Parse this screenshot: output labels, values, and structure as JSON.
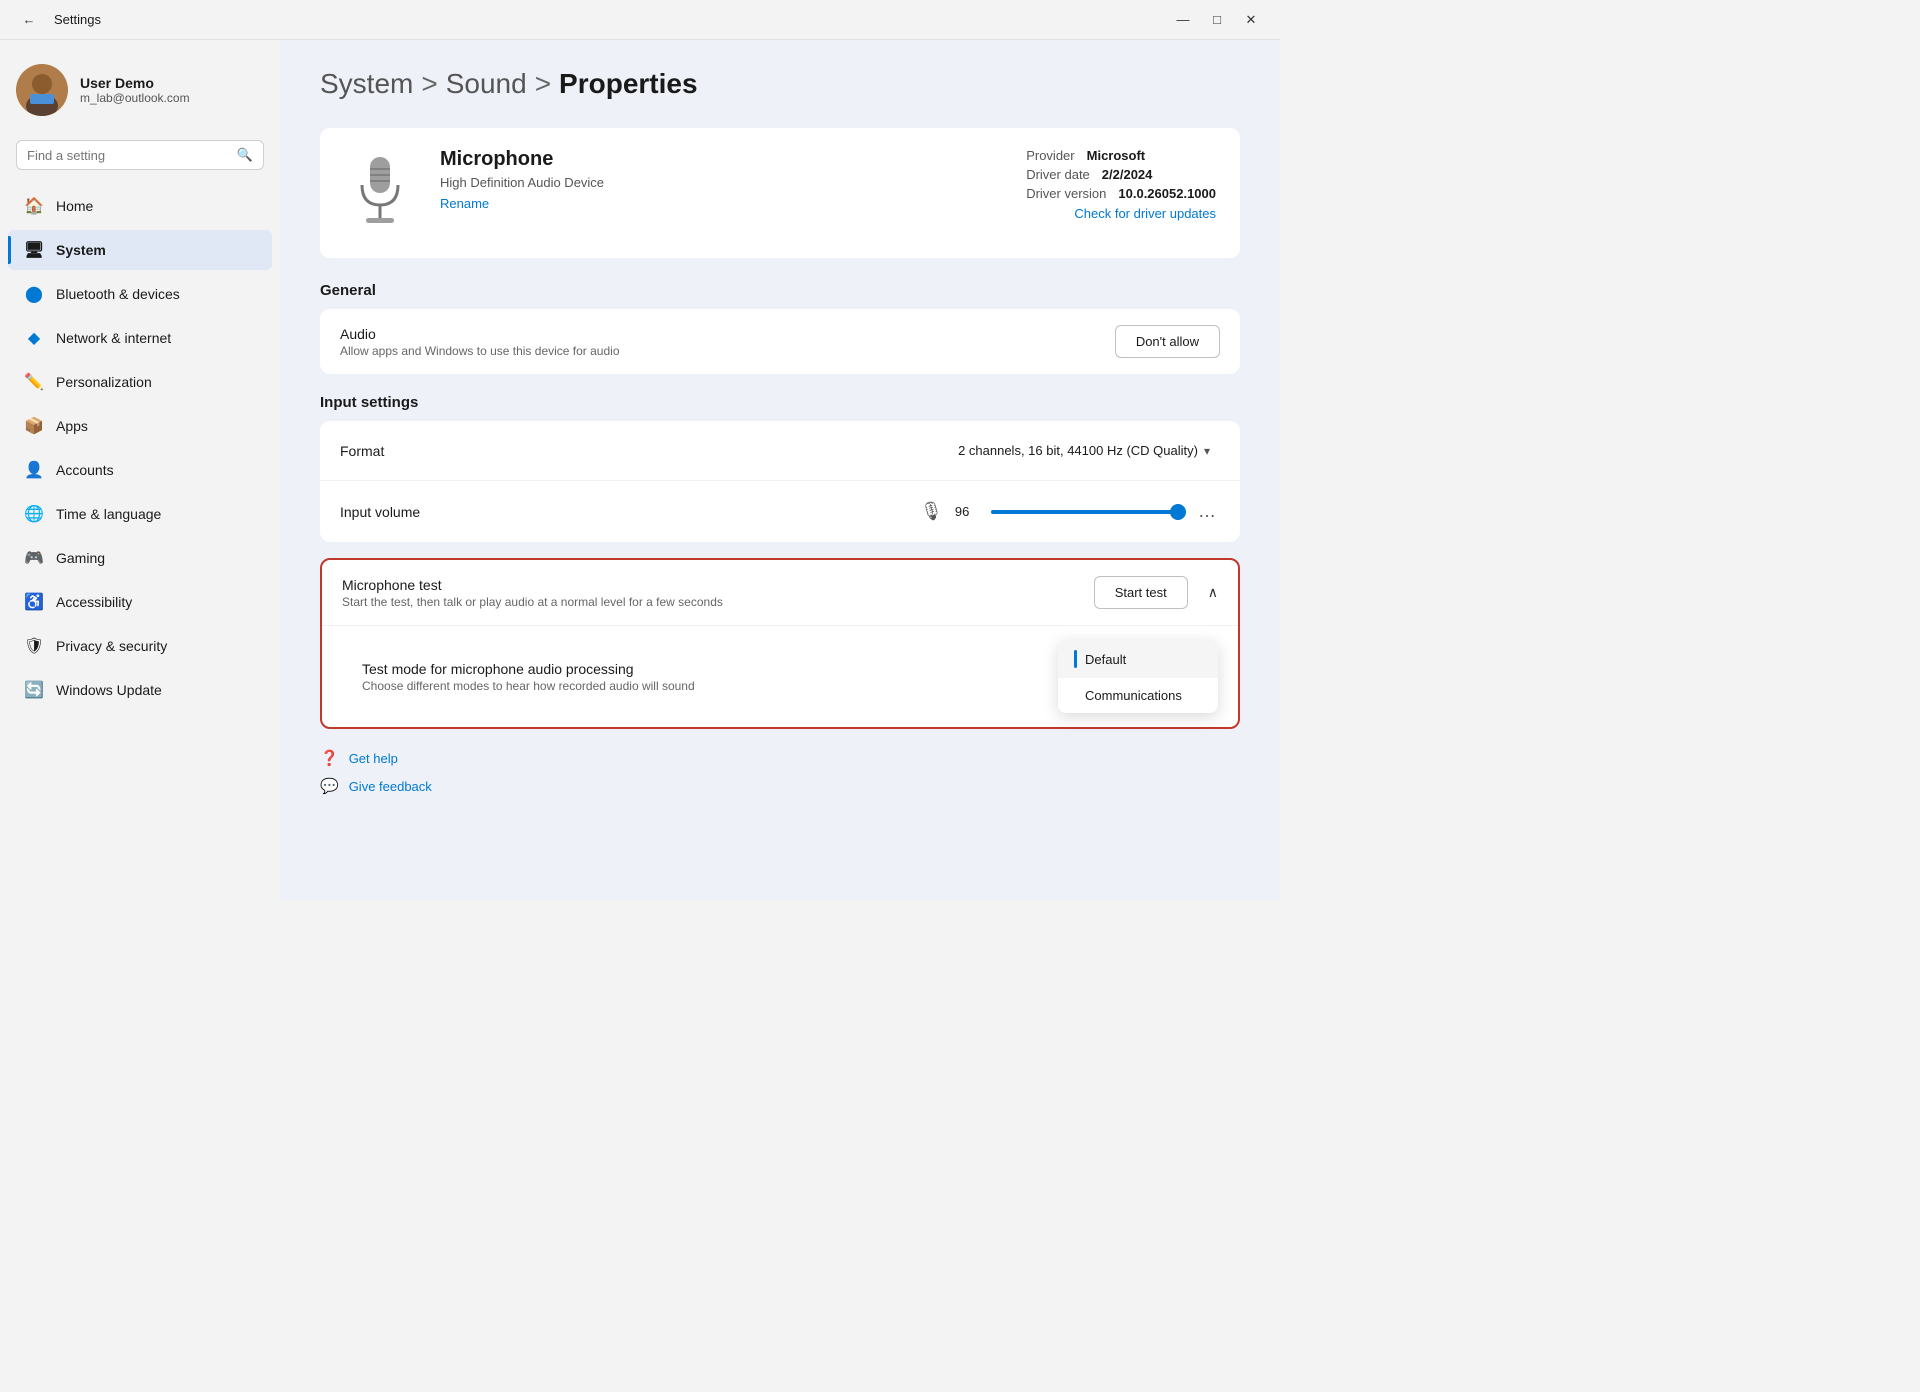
{
  "titleBar": {
    "title": "Settings",
    "backIcon": "←",
    "minimizeIcon": "—",
    "maximizeIcon": "□",
    "closeIcon": "✕"
  },
  "sidebar": {
    "searchPlaceholder": "Find a setting",
    "user": {
      "name": "User Demo",
      "email": "m_lab@outlook.com"
    },
    "navItems": [
      {
        "id": "home",
        "label": "Home",
        "icon": "🏠"
      },
      {
        "id": "system",
        "label": "System",
        "icon": "🖥",
        "active": true
      },
      {
        "id": "bluetooth",
        "label": "Bluetooth & devices",
        "icon": "🔵"
      },
      {
        "id": "network",
        "label": "Network & internet",
        "icon": "🔷"
      },
      {
        "id": "personalization",
        "label": "Personalization",
        "icon": "✏️"
      },
      {
        "id": "apps",
        "label": "Apps",
        "icon": "📦"
      },
      {
        "id": "accounts",
        "label": "Accounts",
        "icon": "👤"
      },
      {
        "id": "time",
        "label": "Time & language",
        "icon": "🌐"
      },
      {
        "id": "gaming",
        "label": "Gaming",
        "icon": "🎮"
      },
      {
        "id": "accessibility",
        "label": "Accessibility",
        "icon": "♿"
      },
      {
        "id": "privacy",
        "label": "Privacy & security",
        "icon": "🛡"
      },
      {
        "id": "update",
        "label": "Windows Update",
        "icon": "🔄"
      }
    ]
  },
  "breadcrumb": {
    "items": [
      "System",
      ">",
      "Sound",
      ">"
    ],
    "current": "Properties"
  },
  "device": {
    "name": "Microphone",
    "subtitle": "High Definition Audio Device",
    "renameLabel": "Rename",
    "provider": "Microsoft",
    "driverDate": "2/2/2024",
    "driverVersion": "10.0.26052.1000",
    "checkDriverLink": "Check for driver updates",
    "providerLabel": "Provider",
    "driverDateLabel": "Driver date",
    "driverVersionLabel": "Driver version"
  },
  "general": {
    "sectionTitle": "General",
    "audioRow": {
      "title": "Audio",
      "subtitle": "Allow apps and Windows to use this device for audio",
      "buttonLabel": "Don't allow"
    }
  },
  "inputSettings": {
    "sectionTitle": "Input settings",
    "formatRow": {
      "title": "Format",
      "value": "2 channels, 16 bit, 44100 Hz (CD Quality)"
    },
    "volumeRow": {
      "title": "Input volume",
      "value": "96",
      "sliderPercent": 96
    }
  },
  "micTest": {
    "title": "Microphone test",
    "subtitle": "Start the test, then talk or play audio at a normal level for a few seconds",
    "startTestLabel": "Start test",
    "subTitle": "Test mode for microphone audio processing",
    "subSubtitle": "Choose different modes to hear how recorded audio will sound",
    "dropdownOptions": [
      {
        "label": "Default",
        "selected": true
      },
      {
        "label": "Communications",
        "selected": false
      }
    ]
  },
  "footer": {
    "getHelpLabel": "Get help",
    "feedbackLabel": "Give feedback"
  }
}
